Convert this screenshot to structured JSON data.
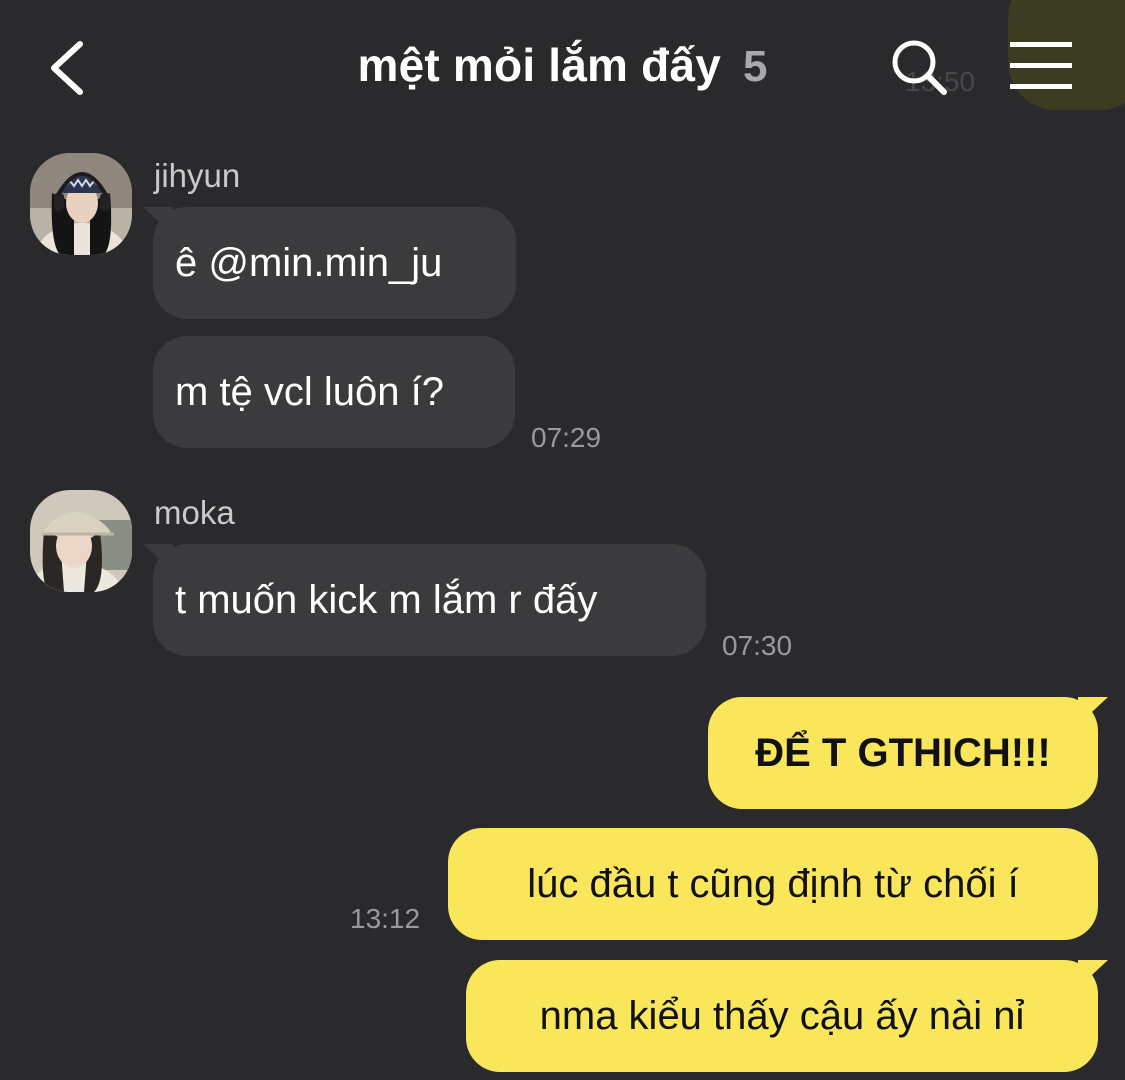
{
  "header": {
    "title": "mệt mỏi lắm đấy",
    "member_count": "5",
    "back_icon": "chevron-left-icon",
    "search_icon": "search-icon",
    "menu_icon": "hamburger-menu-icon"
  },
  "colors": {
    "background": "#2a2a2c",
    "incoming_bubble": "#3b3b3e",
    "outgoing_bubble": "#f9e65a",
    "timestamp": "#9a9a9e",
    "sender_name": "#c9c9cc"
  },
  "messages": [
    {
      "sender": "jihyun",
      "bubbles": [
        "ê @min.min_ju",
        "m tệ vcl luôn í?"
      ],
      "time": "07:29"
    },
    {
      "sender": "moka",
      "bubbles": [
        "t muốn kick m lắm r đấy"
      ],
      "time": "07:30"
    },
    {
      "sender": "me",
      "bubbles": [
        "ĐỂ T GTHICH!!!",
        "lúc đầu t cũng định từ chối í",
        "nma kiểu thấy cậu ấy nài nỉ"
      ],
      "time": "13:12"
    }
  ]
}
